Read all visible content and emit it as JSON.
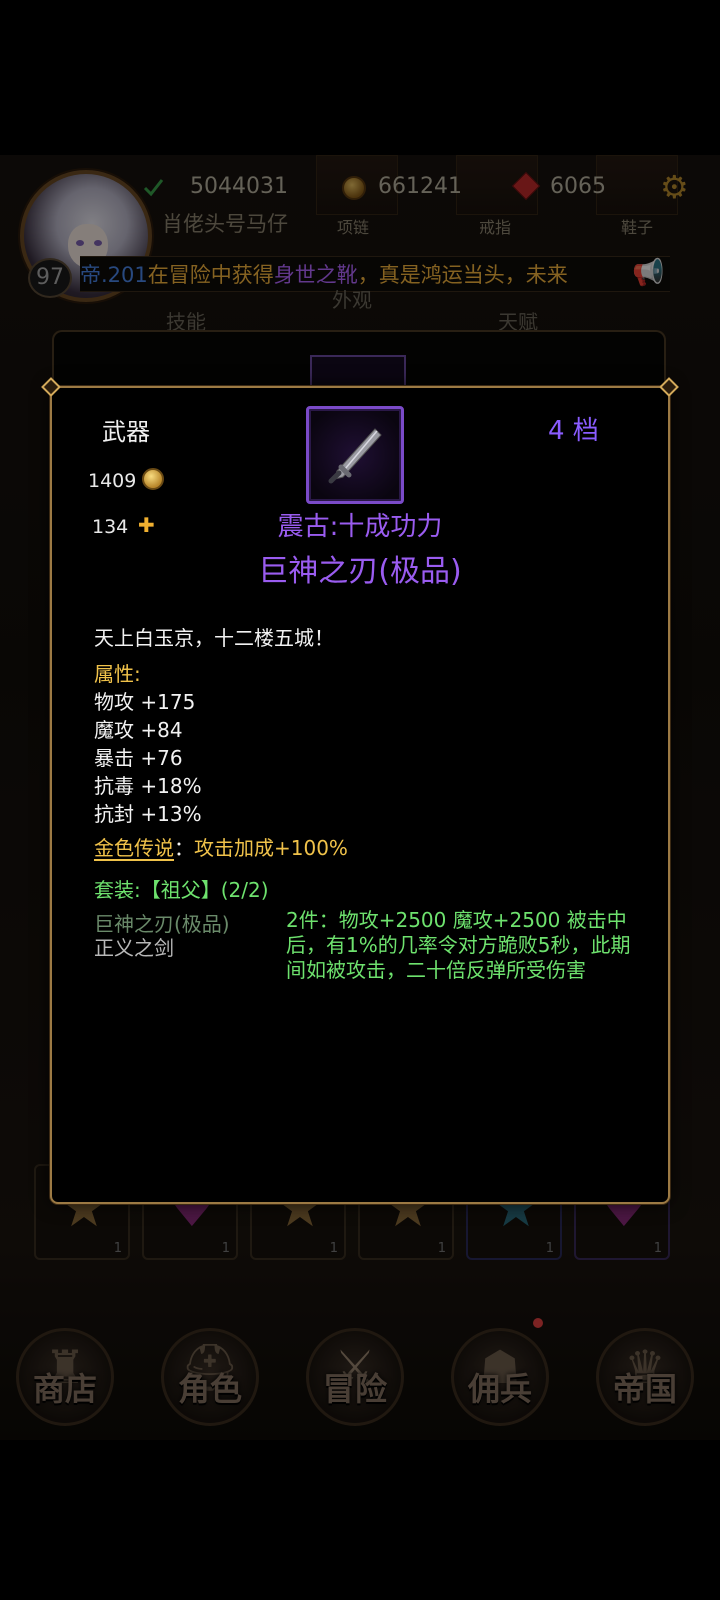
{
  "header": {
    "level": "97",
    "player_name": "肖佬头号马仔",
    "power": "5044031",
    "gold": "661241",
    "gems": "6065",
    "equip_slots": [
      "项链",
      "戒指",
      "鞋子"
    ],
    "tabs": [
      "技能",
      "外观",
      "天赋"
    ]
  },
  "ticker": {
    "part1": "帝.201",
    "part2": "在冒险中获得",
    "part3": "身世之靴",
    "part4": "，真是鸿运当头，未来"
  },
  "inventory_qty": [
    "1",
    "1",
    "1",
    "1",
    "1",
    "1"
  ],
  "bottom_nav": [
    {
      "label": "商店",
      "icon": "castle-icon"
    },
    {
      "label": "角色",
      "icon": "helmet-icon"
    },
    {
      "label": "冒险",
      "icon": "crossed-swords-icon"
    },
    {
      "label": "佣兵",
      "icon": "hooded-mercenary-icon"
    },
    {
      "label": "帝国",
      "icon": "crown-icon"
    }
  ],
  "dialog": {
    "category": "武器",
    "tier": "4  档",
    "gold_value": "1409",
    "fragment_value": "134",
    "prefix": "震古:十成功力",
    "item_name": "巨神之刃(极品)",
    "flavor": "天上白玉京，十二楼五城！",
    "attr_title": "属性:",
    "attributes": [
      "物攻 +175",
      "魔攻 +84",
      "暴击 +76",
      "抗毒 +18%",
      "抗封 +13%"
    ],
    "legend_key": "金色传说",
    "legend_colon": "：",
    "legend_value": "攻击加成+100%",
    "set_title": "套装:【祖父】(2/2)",
    "set_pieces": [
      "巨神之刃(极品)",
      "正义之剑"
    ],
    "set_effect": "2件：物攻+2500 魔攻+2500 被击中后，有1%的几率令对方跪败5秒，此期间如被攻击，二十倍反弹所受伤害"
  },
  "colors": {
    "epic_purple": "#9a5cf0",
    "legend_gold": "#f0c24a",
    "set_green": "#6ee26e",
    "frame_gold": "#9c7a44"
  }
}
